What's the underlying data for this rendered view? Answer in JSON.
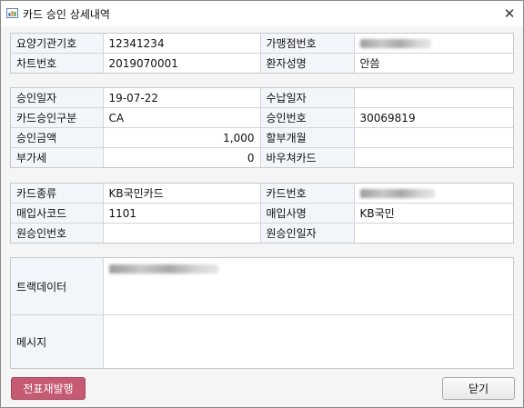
{
  "window": {
    "title": "카드 승인 상세내역",
    "icon": "chart-window-icon",
    "close_glyph": "✕"
  },
  "section1": {
    "rows": [
      {
        "l1": "요양기관기호",
        "v1": "12341234",
        "l2": "가맹점번호",
        "v2": ""
      },
      {
        "l1": "차트번호",
        "v1": "2019070001",
        "l2": "환자성명",
        "v2": "안씀"
      }
    ]
  },
  "section2": {
    "rows": [
      {
        "l1": "승인일자",
        "v1": "19-07-22",
        "l2": "수납일자",
        "v2": ""
      },
      {
        "l1": "카드승인구분",
        "v1": "CA",
        "l2": "승인번호",
        "v2": "30069819"
      },
      {
        "l1": "승인금액",
        "v1": "1,000",
        "l2": "할부개월",
        "v2": ""
      },
      {
        "l1": "부가세",
        "v1": "0",
        "l2": "바우쳐카드",
        "v2": ""
      }
    ]
  },
  "section3": {
    "rows": [
      {
        "l1": "카드종류",
        "v1": "KB국민카드",
        "l2": "카드번호",
        "v2": ""
      },
      {
        "l1": "매입사코드",
        "v1": "1101",
        "l2": "매입사명",
        "v2": "KB국민"
      },
      {
        "l1": "원승인번호",
        "v1": "",
        "l2": "원승인일자",
        "v2": ""
      }
    ]
  },
  "section4": {
    "track_label": "트랙데이터",
    "track_value": "",
    "message_label": "메시지",
    "message_value": ""
  },
  "buttons": {
    "reprint": "전표재발행",
    "close": "닫기"
  },
  "colors": {
    "label_bg": "#f2f6fa",
    "reprint_bg": "#c55a72"
  }
}
